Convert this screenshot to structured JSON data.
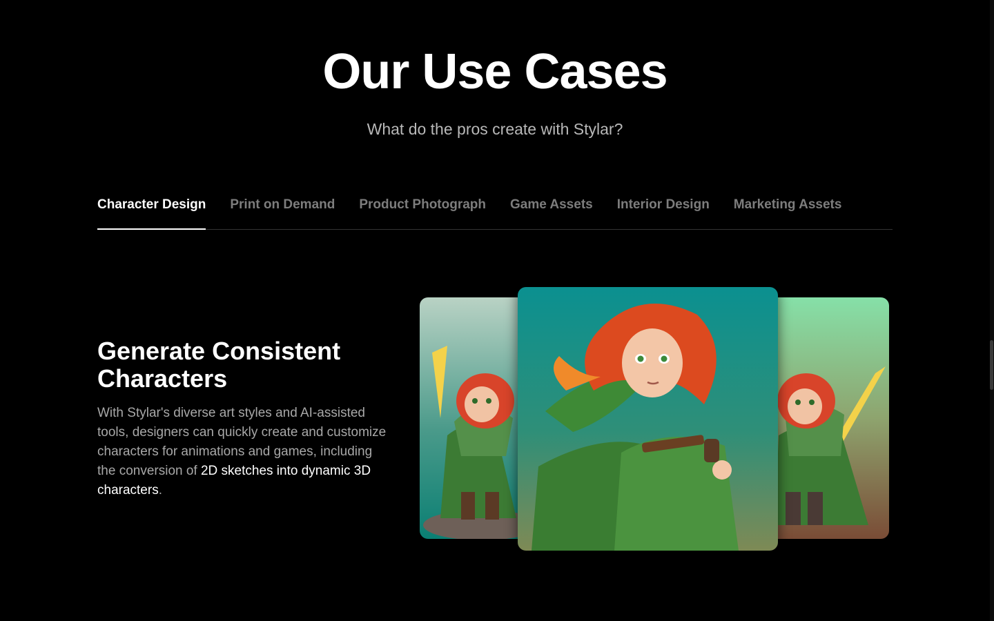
{
  "hero": {
    "title": "Our Use Cases",
    "subtitle": "What do the pros create with Stylar?"
  },
  "tabs": [
    {
      "label": "Character Design",
      "active": true
    },
    {
      "label": "Print on Demand",
      "active": false
    },
    {
      "label": "Product Photograph",
      "active": false
    },
    {
      "label": "Game Assets",
      "active": false
    },
    {
      "label": "Interior Design",
      "active": false
    },
    {
      "label": "Marketing Assets",
      "active": false
    }
  ],
  "feature": {
    "title": "Generate Consistent Characters",
    "text_main": "With Stylar's diverse art styles and AI-assisted tools, designers can quickly create and customize characters for animations and games, including the conversion of ",
    "text_highlight": "2D sketches into dynamic 3D characters",
    "text_end": "."
  },
  "gallery": {
    "images": [
      "character-illustration-left",
      "character-illustration-center",
      "character-illustration-right"
    ]
  },
  "colors": {
    "background": "#000000",
    "tab_inactive": "#7d7d7d",
    "text_muted": "#a8a8a8",
    "hair": "#e2451c",
    "cloak": "#3f8a3a",
    "card_bg_center": "#0d9490"
  }
}
